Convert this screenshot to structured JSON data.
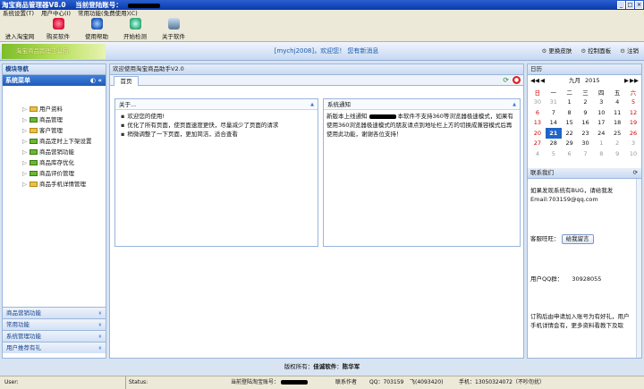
{
  "window": {
    "title": "淘宝商品管理器V8.0",
    "title_extra": "当前登陆账号：",
    "controls": [
      "_",
      "□",
      "×"
    ]
  },
  "menu": [
    "系统设置(T)",
    "用户中心(I)",
    "常用功能(免费使用)(C)"
  ],
  "toolbar": [
    "进入淘宝网",
    "购买软件",
    "使用帮助",
    "开始检测",
    "关于软件"
  ],
  "banner": {
    "logo_text": "淘宝商品管理工具箱",
    "welcome": "[mychj2008]，欢迎您！ 您有新消息",
    "links": [
      "更换皮肤",
      "控制面板",
      "注销"
    ]
  },
  "left": {
    "header": "模块导航",
    "menu_title": "系统菜单",
    "items": [
      "用户资料",
      "商品管理",
      "客户管理",
      "商品定时上下架设置",
      "商品营销功能",
      "商品库存优化",
      "商品评价管理",
      "商品手机详情管理"
    ],
    "accordion": [
      "商品营销功能",
      "常用功能",
      "系统管理功能",
      "用户推荐有礼"
    ]
  },
  "main": {
    "header": "欢迎使用淘宝商品助手V2.0",
    "tab": "首页",
    "about": {
      "title": "关于...",
      "lines": [
        "欢迎您的使用!",
        "优化了所有页面，使页面速度更快，尽量减少了页面的请求",
        "稍微调整了一下页面，更加简洁，适合查看"
      ]
    },
    "notice": {
      "title": "系统通知",
      "lines": [
        "新版本上线通知",
        "本软件不支持360等浏览器极速模式，如果有使用360浏览器极速模式的朋友请点到地址栏上方的切换成兼容模式后再使用此功能，谢谢各位支持！"
      ]
    }
  },
  "calendar": {
    "title": "日历",
    "month": "九月",
    "year": "2015",
    "weekdays": [
      "日",
      "一",
      "二",
      "三",
      "四",
      "五",
      "六"
    ],
    "weeks": [
      [
        "30",
        "31",
        "1",
        "2",
        "3",
        "4",
        "5"
      ],
      [
        "6",
        "7",
        "8",
        "9",
        "10",
        "11",
        "12"
      ],
      [
        "13",
        "14",
        "15",
        "16",
        "17",
        "18",
        "19"
      ],
      [
        "20",
        "21",
        "22",
        "23",
        "24",
        "25",
        "26"
      ],
      [
        "27",
        "28",
        "29",
        "30",
        "1",
        "2",
        "3"
      ],
      [
        "4",
        "5",
        "6",
        "7",
        "8",
        "9",
        "10"
      ]
    ],
    "selected": "21"
  },
  "contact": {
    "title": "联系我们",
    "bug_text": "如果发现系统有BUG，请给我发Email:703159@qq.com",
    "service_label": "客服旺旺：",
    "service_btn": "给我留言",
    "qq_label": "用户QQ群：",
    "qq_value": "30928055",
    "tail": "订购后由申请加入账号为有好礼，用户手机详情会有，更多资料看教下及取"
  },
  "footer": {
    "text": "版权所有：",
    "company": "佳诚软件",
    "author": "陈华军"
  },
  "status": {
    "segs": [
      "User:",
      "Status:",
      "当前登陆淘宝账号：",
      "联系作者",
      "QQ：703159",
      "飞(4093420)",
      "手机：13050324072（不吵勿扰）"
    ]
  }
}
